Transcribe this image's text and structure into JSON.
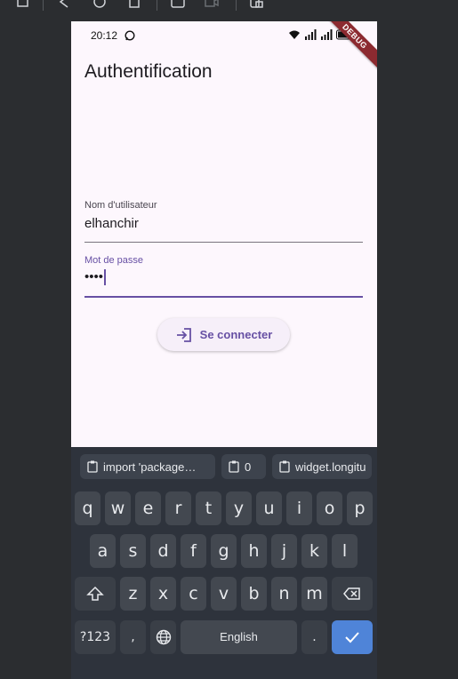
{
  "status_bar": {
    "time": "20:12"
  },
  "debug_banner": "DEBUG",
  "app": {
    "title": "Authentification"
  },
  "form": {
    "username": {
      "label": "Nom d'utilisateur",
      "value": "elhanchir"
    },
    "password": {
      "label": "Mot de passe",
      "masked_value": "••••"
    },
    "login_button": {
      "label": "Se connecter"
    }
  },
  "keyboard": {
    "suggestions": [
      "import 'package…",
      "0",
      "widget.longitu"
    ],
    "row1": [
      "q",
      "w",
      "e",
      "r",
      "t",
      "y",
      "u",
      "i",
      "o",
      "p"
    ],
    "row2": [
      "a",
      "s",
      "d",
      "f",
      "g",
      "h",
      "j",
      "k",
      "l"
    ],
    "row3": [
      "z",
      "x",
      "c",
      "v",
      "b",
      "n",
      "m"
    ],
    "symbols_key": "?123",
    "comma_key": ",",
    "space_label": "English",
    "period_key": "."
  },
  "colors": {
    "accent": "#6750a4",
    "enter_key": "#4f84d8"
  }
}
